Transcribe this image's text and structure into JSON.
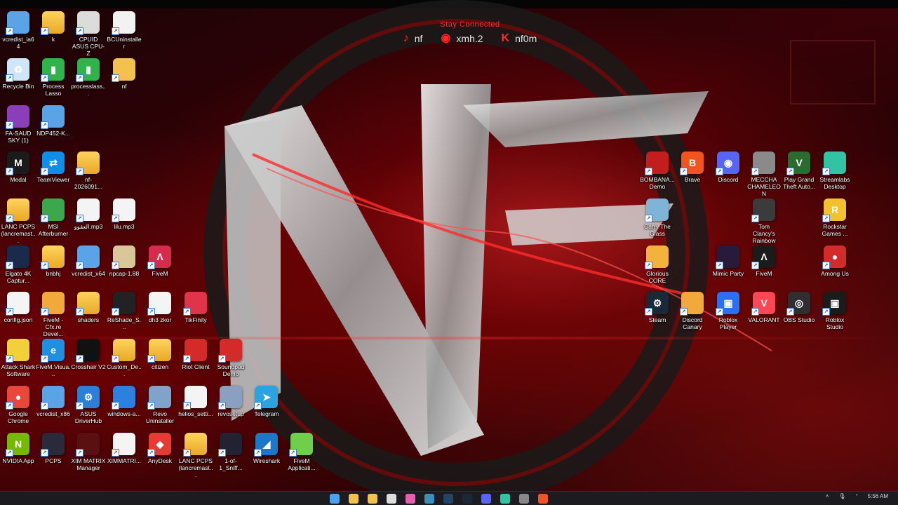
{
  "social": {
    "stay_connected": "Stay Connected",
    "links": [
      {
        "icon": "tiktok-icon",
        "label": "nf"
      },
      {
        "icon": "discord-icon",
        "label": "xmh.2"
      },
      {
        "icon": "kick-icon",
        "label": "nf0m"
      }
    ]
  },
  "desktop_icons": [
    {
      "label": "vcredist_ia64",
      "icon": "installer-icon",
      "color": "#5aa3e6"
    },
    {
      "label": "k",
      "icon": "folder-icon",
      "color": "#f2c14e"
    },
    {
      "label": "CPUID ASUS CPU-Z",
      "icon": "cpuz-icon",
      "color": "#dcdcdc"
    },
    {
      "label": "BCUninstaller",
      "icon": "bcuninstaller-icon",
      "color": "#f2f2f2"
    },
    {
      "label": "Recycle Bin",
      "icon": "recycle-bin-icon",
      "color": "#cfe6f7"
    },
    {
      "label": "Process Lasso",
      "icon": "process-lasso-icon",
      "color": "#2fb34a"
    },
    {
      "label": "processlass...",
      "icon": "process-lasso-icon",
      "color": "#2fb34a"
    },
    {
      "label": "nf",
      "icon": "image-icon",
      "color": "#f2c14e"
    },
    {
      "label": "FA-SAUD SKY (1)",
      "icon": "winrar-icon",
      "color": "#8a3fb8"
    },
    {
      "label": "NDP452-K...",
      "icon": "installer-icon",
      "color": "#5aa3e6"
    },
    {
      "label": "Medal",
      "icon": "medal-icon",
      "color": "#1b1b1b"
    },
    {
      "label": "TeamViewer",
      "icon": "teamviewer-icon",
      "color": "#0e8ee9"
    },
    {
      "label": "nf-2026091...",
      "icon": "folder-icon",
      "color": "#f2c14e"
    },
    {
      "label": "LANC PCPS (lancremast...",
      "icon": "folder-icon",
      "color": "#f2c14e"
    },
    {
      "label": "MSI Afterburner",
      "icon": "msi-afterburner-icon",
      "color": "#3aa84b"
    },
    {
      "label": "العقوو.mp3",
      "icon": "file-icon",
      "color": "#f4f4f4"
    },
    {
      "label": "lilu.mp3",
      "icon": "file-icon",
      "color": "#f4f4f4"
    },
    {
      "label": "Elgato 4K Captur...",
      "icon": "elgato-icon",
      "color": "#1a2a4a"
    },
    {
      "label": "bnbhj",
      "icon": "folder-icon",
      "color": "#f2c14e"
    },
    {
      "label": "vcredist_x64",
      "icon": "installer-icon",
      "color": "#5aa3e6"
    },
    {
      "label": "npcap-1.88",
      "icon": "npcap-icon",
      "color": "#d9c79a"
    },
    {
      "label": "FiveM",
      "icon": "fivem-icon",
      "color": "#d62b4b"
    },
    {
      "label": "config.json",
      "icon": "file-icon",
      "color": "#f4f4f4"
    },
    {
      "label": "FiveM - Cfx.re Devel...",
      "icon": "fivem-devel-icon",
      "color": "#f2a93b"
    },
    {
      "label": "shaders",
      "icon": "folder-icon",
      "color": "#f2c14e"
    },
    {
      "label": "ReShade_S...",
      "icon": "reshade-icon",
      "color": "#222222"
    },
    {
      "label": "dh3 zkor",
      "icon": "file-icon",
      "color": "#f4f4f4"
    },
    {
      "label": "TikFinity",
      "icon": "tikfinity-icon",
      "color": "#e0344a"
    },
    {
      "label": "Attack Shark Software",
      "icon": "attack-shark-icon",
      "color": "#f2d03b"
    },
    {
      "label": "FiveM.Visua...",
      "icon": "edge-icon",
      "color": "#1f8fe0"
    },
    {
      "label": "Crosshair V2",
      "icon": "crosshair-icon",
      "color": "#111111"
    },
    {
      "label": "Custom_De...",
      "icon": "folder-icon",
      "color": "#f2c14e"
    },
    {
      "label": "citizen",
      "icon": "folder-icon",
      "color": "#f2c14e"
    },
    {
      "label": "Riot Client",
      "icon": "riot-client-icon",
      "color": "#d42a2a"
    },
    {
      "label": "Soundpad Demo",
      "icon": "soundpad-icon",
      "color": "#d42a2a"
    },
    {
      "label": "Google Chrome",
      "icon": "chrome-icon",
      "color": "#e9473b"
    },
    {
      "label": "vcredist_x86",
      "icon": "installer-icon",
      "color": "#5aa3e6"
    },
    {
      "label": "ASUS DriverHub",
      "icon": "gear-icon",
      "color": "#2a7fd6"
    },
    {
      "label": "windows-a...",
      "icon": "octopus-icon",
      "color": "#2d7fe0"
    },
    {
      "label": "Revo Uninstaller",
      "icon": "revo-uninstaller-icon",
      "color": "#7fa3c9"
    },
    {
      "label": "helios_setti...",
      "icon": "settings-file-icon",
      "color": "#f4f4f4"
    },
    {
      "label": "revosetup",
      "icon": "revo-setup-icon",
      "color": "#8aa0c0"
    },
    {
      "label": "Telegram",
      "icon": "telegram-icon",
      "color": "#2aa3e0"
    },
    {
      "label": "NVIDIA App",
      "icon": "nvidia-icon",
      "color": "#76b900"
    },
    {
      "label": "PCPS",
      "icon": "router-icon",
      "color": "#2a2a3a"
    },
    {
      "label": "XIM MATRIX Manager",
      "icon": "xim-matrix-icon",
      "color": "#5a1010"
    },
    {
      "label": "XIMMATRI...",
      "icon": "file-icon",
      "color": "#f4f4f4"
    },
    {
      "label": "AnyDesk",
      "icon": "anydesk-icon",
      "color": "#e53b34"
    },
    {
      "label": "LANC PCPS (lancremast...",
      "icon": "folder-icon",
      "color": "#f2c14e"
    },
    {
      "label": "1-of-1_Sniff...",
      "icon": "image-icon",
      "color": "#223"
    },
    {
      "label": "Wireshark",
      "icon": "wireshark-icon",
      "color": "#1b78c8"
    },
    {
      "label": "FiveM Applicati...",
      "icon": "fivem-app-icon",
      "color": "#6fcf4a"
    },
    {
      "label": "BOMBANA... Demo",
      "icon": "bombana-icon",
      "color": "#c21e1e"
    },
    {
      "label": "Brave",
      "icon": "brave-icon",
      "color": "#f2531f"
    },
    {
      "label": "Discord",
      "icon": "discord-icon",
      "color": "#5865f2"
    },
    {
      "label": "MECCHA CHAMELEON",
      "icon": "game-icon",
      "color": "#8a8a8a"
    },
    {
      "label": "Play Grand Theft Auto...",
      "icon": "gta-icon",
      "color": "#2c6b2f"
    },
    {
      "label": "Streamlabs Desktop",
      "icon": "streamlabs-icon",
      "color": "#31c3a2"
    },
    {
      "label": "Carry The Glass",
      "icon": "game-icon",
      "color": "#7fb4d6"
    },
    {
      "label": "Tom Clancy's Rainbow Si...",
      "icon": "rainbow-six-icon",
      "color": "#3b3b3b"
    },
    {
      "label": "Rockstar Games ...",
      "icon": "rockstar-icon",
      "color": "#f2c12e"
    },
    {
      "label": "Glorious CORE",
      "icon": "glorious-icon",
      "color": "#f2b23b"
    },
    {
      "label": "Mimic Party",
      "icon": "mimic-party-icon",
      "color": "#2a1a3a"
    },
    {
      "label": "FiveM",
      "icon": "fivem-icon",
      "color": "#1b1b1b"
    },
    {
      "label": "Among Us",
      "icon": "among-us-icon",
      "color": "#d42a2a"
    },
    {
      "label": "Steam",
      "icon": "steam-icon",
      "color": "#1b2838"
    },
    {
      "label": "Discord Canary",
      "icon": "discord-canary-icon",
      "color": "#f2a93b"
    },
    {
      "label": "Roblox Player",
      "icon": "roblox-icon",
      "color": "#2e6ff2"
    },
    {
      "label": "VALORANT",
      "icon": "valorant-icon",
      "color": "#ff4655"
    },
    {
      "label": "OBS Studio",
      "icon": "obs-icon",
      "color": "#302e31"
    },
    {
      "label": "Roblox Studio",
      "icon": "roblox-studio-icon",
      "color": "#1b1b1b"
    }
  ],
  "taskbar": {
    "pinned": [
      {
        "icon": "windows-start-icon",
        "color": "#4aa3f0"
      },
      {
        "icon": "file-explorer-icon",
        "color": "#f2c14e"
      },
      {
        "icon": "folder-icon",
        "color": "#f2c14e"
      },
      {
        "icon": "clock-icon",
        "color": "#dddddd"
      },
      {
        "icon": "app-icon",
        "color": "#e85fae"
      },
      {
        "icon": "app-icon",
        "color": "#3a8fbf"
      },
      {
        "icon": "app-icon",
        "color": "#224466"
      },
      {
        "icon": "steam-icon",
        "color": "#1b2838"
      },
      {
        "icon": "discord-icon",
        "color": "#5865f2"
      },
      {
        "icon": "streamlabs-icon",
        "color": "#31c3a2"
      },
      {
        "icon": "app-icon",
        "color": "#888888"
      },
      {
        "icon": "brave-icon",
        "color": "#f2531f"
      }
    ],
    "time": "5:56 AM"
  }
}
